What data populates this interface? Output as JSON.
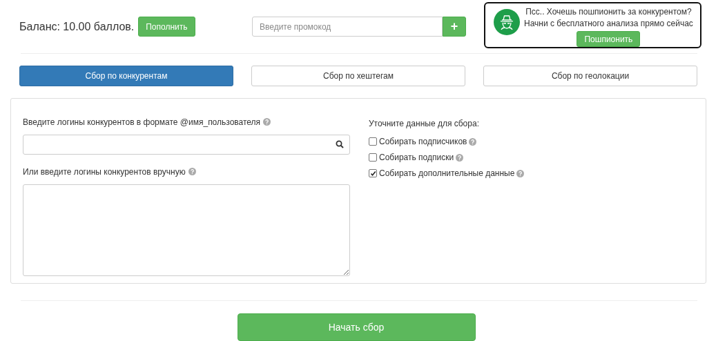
{
  "balance": {
    "text": "Баланс: 10.00 баллов.",
    "button": "Пополнить"
  },
  "promo": {
    "placeholder": "Введите промокод",
    "button": "+"
  },
  "ad": {
    "lines": [
      "Псс.. Хочешь пошпионить за конкурентом?",
      "Начни с бесплатного анализа прямо сейчас"
    ],
    "button": "Пошпионить"
  },
  "tabs": [
    {
      "label": "Сбор по конкурентам",
      "selected": true
    },
    {
      "label": "Сбор по хештегам",
      "selected": false
    },
    {
      "label": "Сбор по геолокации",
      "selected": false
    }
  ],
  "form": {
    "logins_label": "Введите логины конкурентов в формате @имя_пользователя",
    "manual_label": "Или введите логины конкурентов вручную",
    "options_heading": "Уточните данные для сбора:",
    "options": [
      {
        "label": "Собирать подписчиков",
        "checked": false
      },
      {
        "label": "Собирать подписки",
        "checked": false
      },
      {
        "label": "Собирать дополнительные данные",
        "checked": true
      }
    ]
  },
  "start_button": "Начать сбор"
}
